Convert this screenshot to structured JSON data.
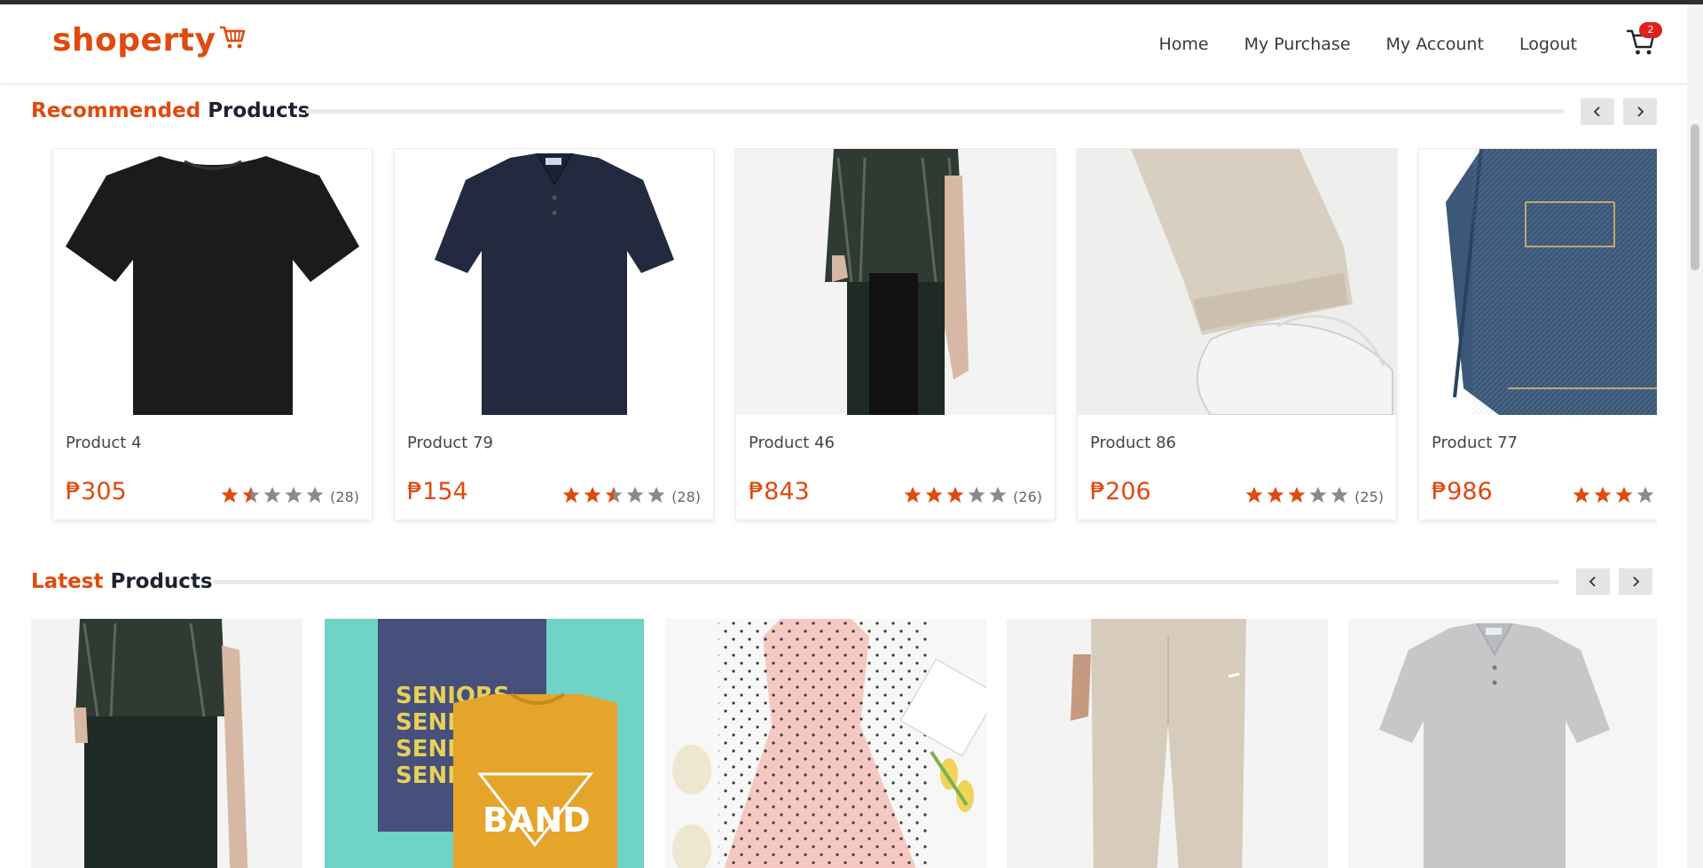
{
  "brand": {
    "name": "shoperty",
    "accent": "#e04a0f"
  },
  "nav": {
    "items": [
      "Home",
      "My Purchase",
      "My Account",
      "Logout"
    ],
    "cart_count": "2"
  },
  "recommended": {
    "title_accent": "Recommended",
    "title_rest": "Products",
    "products": [
      {
        "name": "Product 4",
        "price": "₱305",
        "rating": 1.5,
        "count": "(28)",
        "image": "black-tshirt"
      },
      {
        "name": "Product 79",
        "price": "₱154",
        "rating": 2.5,
        "count": "(28)",
        "image": "navy-polo"
      },
      {
        "name": "Product 46",
        "price": "₱843",
        "rating": 3,
        "count": "(26)",
        "image": "fur-vest-coat"
      },
      {
        "name": "Product 86",
        "price": "₱206",
        "rating": 3,
        "count": "(25)",
        "image": "joggers-sneakers"
      },
      {
        "name": "Product 77",
        "price": "₱986",
        "rating": 3,
        "count": "",
        "image": "denim-jacket"
      }
    ]
  },
  "latest": {
    "title_accent": "Latest",
    "title_rest": "Products",
    "products": [
      {
        "image": "fur-vest-coat"
      },
      {
        "image": "seniors-band-tees"
      },
      {
        "image": "pink-polka-dress"
      },
      {
        "image": "beige-sweatpants"
      },
      {
        "image": "grey-polo"
      }
    ]
  },
  "colors": {
    "star_on": "#e04a0f",
    "star_off": "#8a8a8a"
  }
}
